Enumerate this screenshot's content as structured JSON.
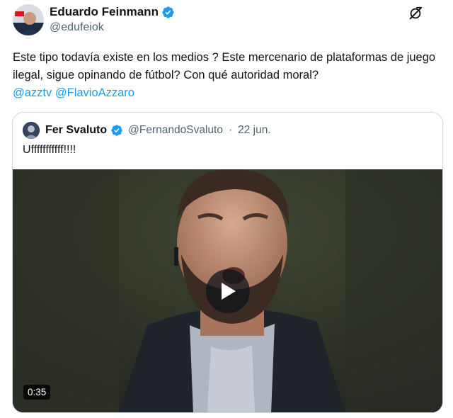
{
  "author": {
    "name": "Eduardo Feinmann",
    "handle": "@edufeiok",
    "verified_color": "#1d9bf0",
    "avatar_badge_text": "A24"
  },
  "tweet": {
    "text": "Este tipo todavía existe en los medios ?  Este mercenario de plataformas de juego ilegal, sigue opinando de fútbol?  Con qué autoridad moral?",
    "mentions": [
      "@azztv",
      "@FlavioAzzaro"
    ]
  },
  "quote": {
    "name": "Fer Svaluto",
    "handle": "@FernandoSvaluto",
    "separator": "·",
    "date": "22 jun.",
    "text": "Ufffffffffff!!!!",
    "video": {
      "duration": "0:35",
      "play_icon": "play-icon"
    }
  },
  "colors": {
    "link": "#1d9bf0",
    "text": "#0f1419",
    "muted": "#536471",
    "border": "#cfd9de"
  },
  "icons": [
    "verified-badge-icon",
    "grok-icon",
    "play-icon"
  ]
}
